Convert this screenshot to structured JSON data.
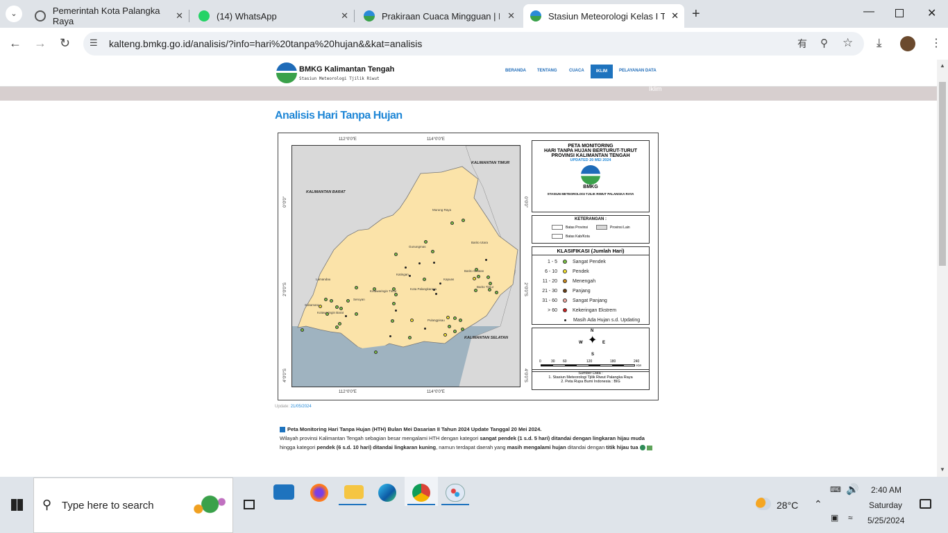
{
  "tabs": [
    {
      "title": "Pemerintah Kota Palangka Raya",
      "icon": "globe-icon"
    },
    {
      "title": "(14) WhatsApp",
      "icon": "whatsapp-icon"
    },
    {
      "title": "Prakiraan Cuaca Mingguan | BM",
      "icon": "bmkg-icon"
    },
    {
      "title": "Stasiun Meteorologi Kelas I Tjili",
      "icon": "bmkg-icon"
    }
  ],
  "browser": {
    "url": "kalteng.bmkg.go.id/analisis/?info=hari%20tanpa%20hujan&&kat=analisis"
  },
  "site": {
    "logo_title": "BMKG Kalimantan Tengah",
    "logo_sub": "Stasiun Meteorologi Tjilik Riwut",
    "nav": [
      "BERANDA",
      "TENTANG",
      "CUACA",
      "IKLIM",
      "PELAYANAN DATA"
    ],
    "breadcrumb": "Iklim",
    "heading": "Analisis Hari Tanpa Hujan",
    "update_label": "Update:",
    "update_date": "21/05/2024"
  },
  "map": {
    "title1": "PETA MONITORING",
    "title2": "HARI TANPA HUJAN BERTURUT-TURUT",
    "title3": "PROVINSI KALIMANTAN TENGAH",
    "updated": "UPDATED 20 MEI 2024",
    "bmkg": "BMKG",
    "station": "STASIUN METEOROLOGI TJILIK RIWUT PALANGKA RAYA",
    "lon1": "112°0'0\"E",
    "lon2": "114°0'0\"E",
    "lat1": "0°0'0\"",
    "lat2": "2°0'0\"S",
    "lat3": "4°0'0\"S",
    "regions": {
      "barat": "KALIMANTAN BARAT",
      "timur": "KALIMANTAN TIMUR",
      "selatan": "KALIMANTAN SELATAN"
    },
    "keterangan_title": "KETERANGAN :",
    "ket": [
      "Batas Provinsi",
      "Provinsi Lain",
      "Batas Kab/Kota"
    ],
    "klas_title": "KLASIFIKASI (Jumlah Hari)",
    "klas": [
      {
        "range": "1 - 5",
        "label": "Sangat Pendek",
        "color": "#7cc242"
      },
      {
        "range": "6 - 10",
        "label": "Pendek",
        "color": "#f4e22b"
      },
      {
        "range": "11 - 20",
        "label": "Menengah",
        "color": "#c98a1c"
      },
      {
        "range": "21 - 30",
        "label": "Panjang",
        "color": "#6b3f14"
      },
      {
        "range": "31 - 60",
        "label": "Sangat Panjang",
        "color": "#f1a9a0"
      },
      {
        "range": "> 60",
        "label": "Kekeringan Ekstrem",
        "color": "#d0201f"
      },
      {
        "range": "",
        "label": "Masih Ada Hujan s.d. Updating",
        "color": "#222222"
      }
    ],
    "compass": {
      "n": "N",
      "s": "S",
      "e": "E",
      "w": "W"
    },
    "scale": [
      "0",
      "30",
      "60",
      "120",
      "180",
      "240"
    ],
    "scale_unit": "KM",
    "sumber_title": "Sumber Data :",
    "sumber": [
      "1. Stasiun Meteorologi Tjilik Riwut Palangka Raya",
      "2. Peta Rupa Bumi Indonesia : BIG"
    ],
    "places": [
      "Murung Raya",
      "Barito Utara",
      "Gunungmas",
      "Katingan",
      "Kapuas",
      "Kota Palangkaraya",
      "Lamandau",
      "Seruyan",
      "Kotawaringin Timur",
      "Sukamara",
      "Kotawaringin Barat",
      "Pulangpisau",
      "Barito Selatan",
      "Barito Timur"
    ]
  },
  "text": {
    "p1": "Peta Monitoring Hari Tanpa Hujan (HTH) Bulan Mei Dasarian II Tahun 2024 Update Tanggal 20 Mei 2024.",
    "p2a": "Wilayah provinsi Kalimantan Tengah sebagian besar mengalami HTH dengan kategori ",
    "p2b": "sangat pendek (1 s.d. 5 hari) ditandai dengan lingkaran hijau muda",
    "p2c": " hingga kategori ",
    "p2d": "pendek (6 s.d. 10 hari) ditandai lingkaran kuning",
    "p2e": ", namun terdapat daerah yang ",
    "p2f": "masih mengalami hujan",
    "p2g": " ditandai dengan ",
    "p2h": "titik hijau tua"
  },
  "taskbar": {
    "search_placeholder": "Type here to search",
    "weather": "28°C",
    "time": "2:40 AM",
    "day": "Saturday",
    "date": "5/25/2024"
  }
}
